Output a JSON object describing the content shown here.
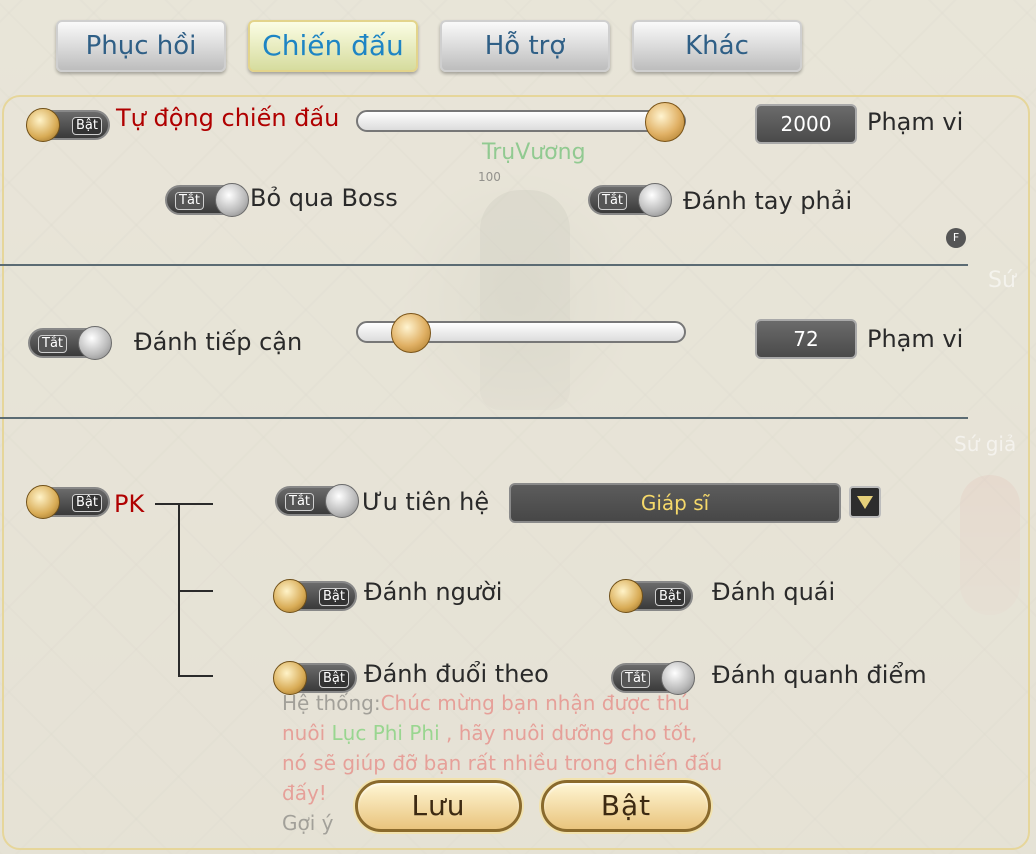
{
  "tabs": [
    {
      "label": "Phục hồi",
      "active": false
    },
    {
      "label": "Chiến đấu",
      "active": true
    },
    {
      "label": "Hỗ trợ",
      "active": false
    },
    {
      "label": "Khác",
      "active": false
    }
  ],
  "toggle_labels": {
    "on": "Bật",
    "off": "Tắt"
  },
  "auto_combat": {
    "label": "Tự  động chiến đấu",
    "state": "on",
    "slider_fraction": 0.93,
    "range_value": "2000",
    "range_label": "Phạm vi"
  },
  "skip_boss": {
    "label": "Bỏ qua Boss",
    "state": "off"
  },
  "right_hand": {
    "label": "Đánh tay phải",
    "state": "off"
  },
  "approach": {
    "label": "Đánh tiếp cận",
    "state": "off",
    "slider_fraction": 0.16,
    "range_value": "72",
    "range_label": "Phạm vi"
  },
  "pk": {
    "label": "PK",
    "state": "on",
    "priority": {
      "label": "Ưu tiên hệ",
      "state": "off",
      "selected": "Giáp sĩ"
    },
    "attack_player": {
      "label": "Đánh người",
      "state": "on"
    },
    "attack_monster": {
      "label": "Đánh quái",
      "state": "on"
    },
    "chase": {
      "label": "Đánh đuổi theo",
      "state": "on"
    },
    "attack_around": {
      "label": "Đánh quanh điểm",
      "state": "off"
    }
  },
  "buttons": {
    "save": "Lưu",
    "enable": "Bật"
  },
  "game_bg": {
    "character_name": "TrụVương",
    "hp": "100",
    "npc_label_1": "Sứ",
    "npc_label_2": "Sứ giả",
    "f_key": "F",
    "chat_prefix": "Hệ thống:",
    "chat_msg_1": "Chúc mừng bạn nhận được thú",
    "chat_msg_2a": "nuôi ",
    "chat_pet": "Lục Phi Phi",
    "chat_msg_2b": " , hãy nuôi dưỡng cho tốt,",
    "chat_msg_3": "nó sẽ giúp đỡ bạn rất nhiều trong chiến đấu",
    "chat_msg_4": "đấy!",
    "chat_hint": "Gợi ý"
  }
}
